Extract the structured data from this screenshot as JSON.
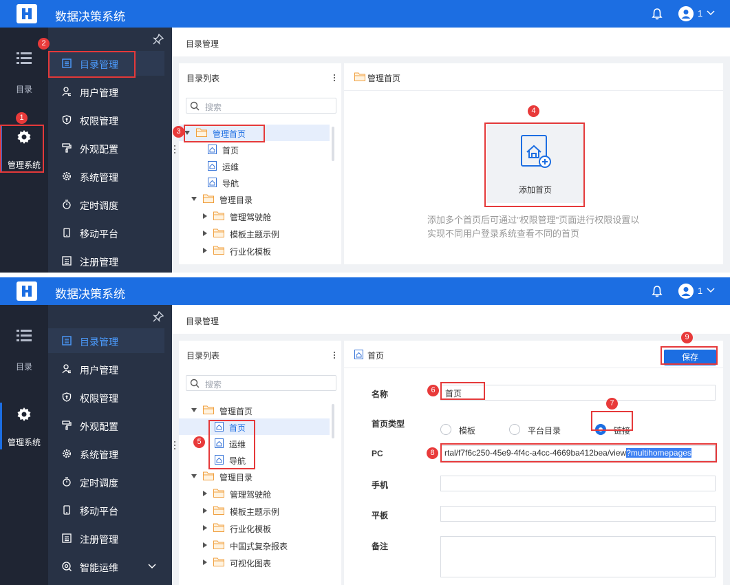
{
  "colors": {
    "topbar": "#1c6ee2",
    "rail": "#1f2533",
    "menu": "#283245",
    "accent": "#1c6ee2",
    "annotation": "#e5393a"
  },
  "app": {
    "title": "数据决策系统",
    "user": "1"
  },
  "rail": {
    "catalog": "目录",
    "admin": "管理系统"
  },
  "menu": {
    "items": [
      {
        "label": "目录管理",
        "icon": "catalog-icon"
      },
      {
        "label": "用户管理",
        "icon": "user-icon"
      },
      {
        "label": "权限管理",
        "icon": "shield-icon"
      },
      {
        "label": "外观配置",
        "icon": "paint-roller-icon"
      },
      {
        "label": "系统管理",
        "icon": "gear-icon"
      },
      {
        "label": "定时调度",
        "icon": "stopwatch-icon"
      },
      {
        "label": "移动平台",
        "icon": "mobile-icon"
      },
      {
        "label": "注册管理",
        "icon": "register-icon"
      },
      {
        "label": "智能运维",
        "icon": "ops-icon"
      }
    ]
  },
  "page": {
    "title": "目录管理"
  },
  "list": {
    "title": "目录列表",
    "search_placeholder": "搜索"
  },
  "tree": {
    "root1": "管理首页",
    "leaves": [
      "首页",
      "运维",
      "导航"
    ],
    "root2": "管理目录",
    "children": [
      "管理驾驶舱",
      "模板主题示例",
      "行业化模板",
      "中国式复杂报表",
      "可视化图表"
    ]
  },
  "panel1": {
    "header": "管理首页",
    "add_label": "添加首页",
    "hint": "添加多个首页后可通过\"权限管理\"页面进行权限设置以实现不同用户登录系统查看不同的首页"
  },
  "panel2": {
    "header": "首页",
    "save": "保存",
    "fields": {
      "name_label": "名称",
      "name_value": "首页",
      "type_label": "首页类型",
      "type_options": [
        "模板",
        "平台目录",
        "链接"
      ],
      "type_selected": "链接",
      "pc_label": "PC",
      "pc_value": "rtal/f7f6c250-45e9-4f4c-a4cc-4669ba412bea/view",
      "pc_value_selected": "?multihomepages",
      "mobile_label": "手机",
      "tablet_label": "平板",
      "remark_label": "备注"
    }
  },
  "annotations": [
    "1",
    "2",
    "3",
    "4",
    "5",
    "6",
    "7",
    "8",
    "9"
  ]
}
